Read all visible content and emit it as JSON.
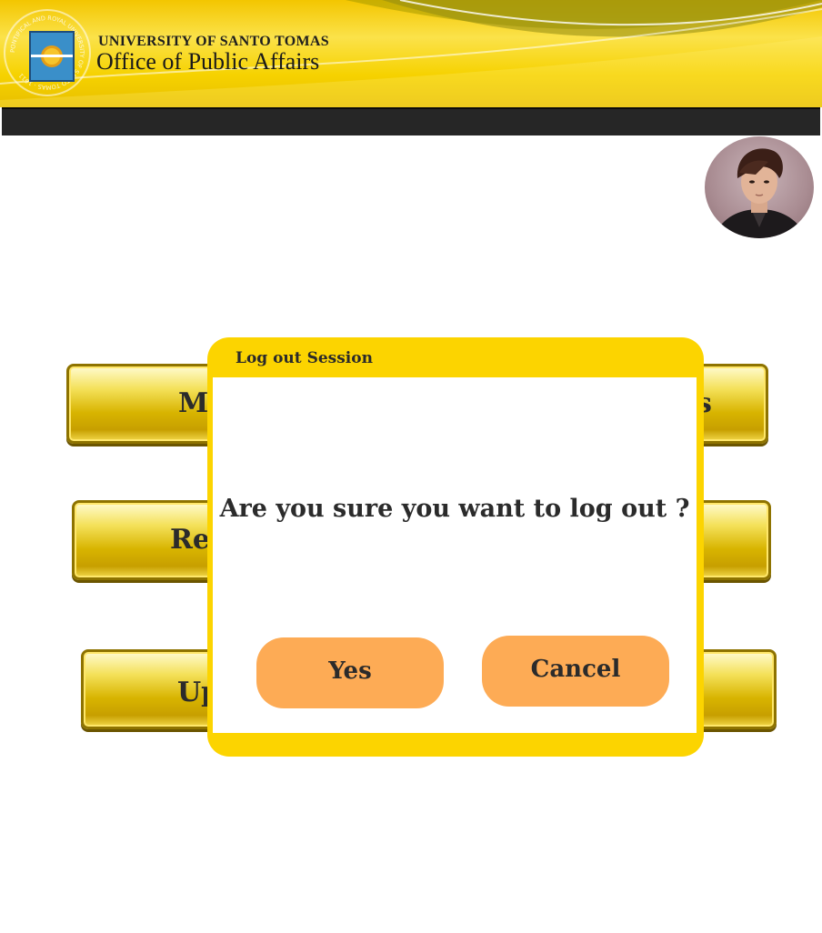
{
  "header": {
    "seal_text": "PONTIFICAL AND ROYAL UNIVERSITY OF SANTO TOMAS · 1611",
    "university": "UNIVERSITY OF SANTO TOMAS",
    "office": "Office of Public Affairs"
  },
  "menu": {
    "items": [
      {
        "label": "Ma",
        "label_right": "s"
      },
      {
        "label": "Re"
      },
      {
        "label": "Up"
      }
    ]
  },
  "dialog": {
    "title": "Log out Session",
    "message": "Are you sure you want to log out ?",
    "yes_label": "Yes",
    "cancel_label": "Cancel"
  },
  "colors": {
    "header_yellow": "#f6d200",
    "navbar": "#262626",
    "dialog_frame": "#fcd400",
    "dialog_button": "#fdab55"
  }
}
